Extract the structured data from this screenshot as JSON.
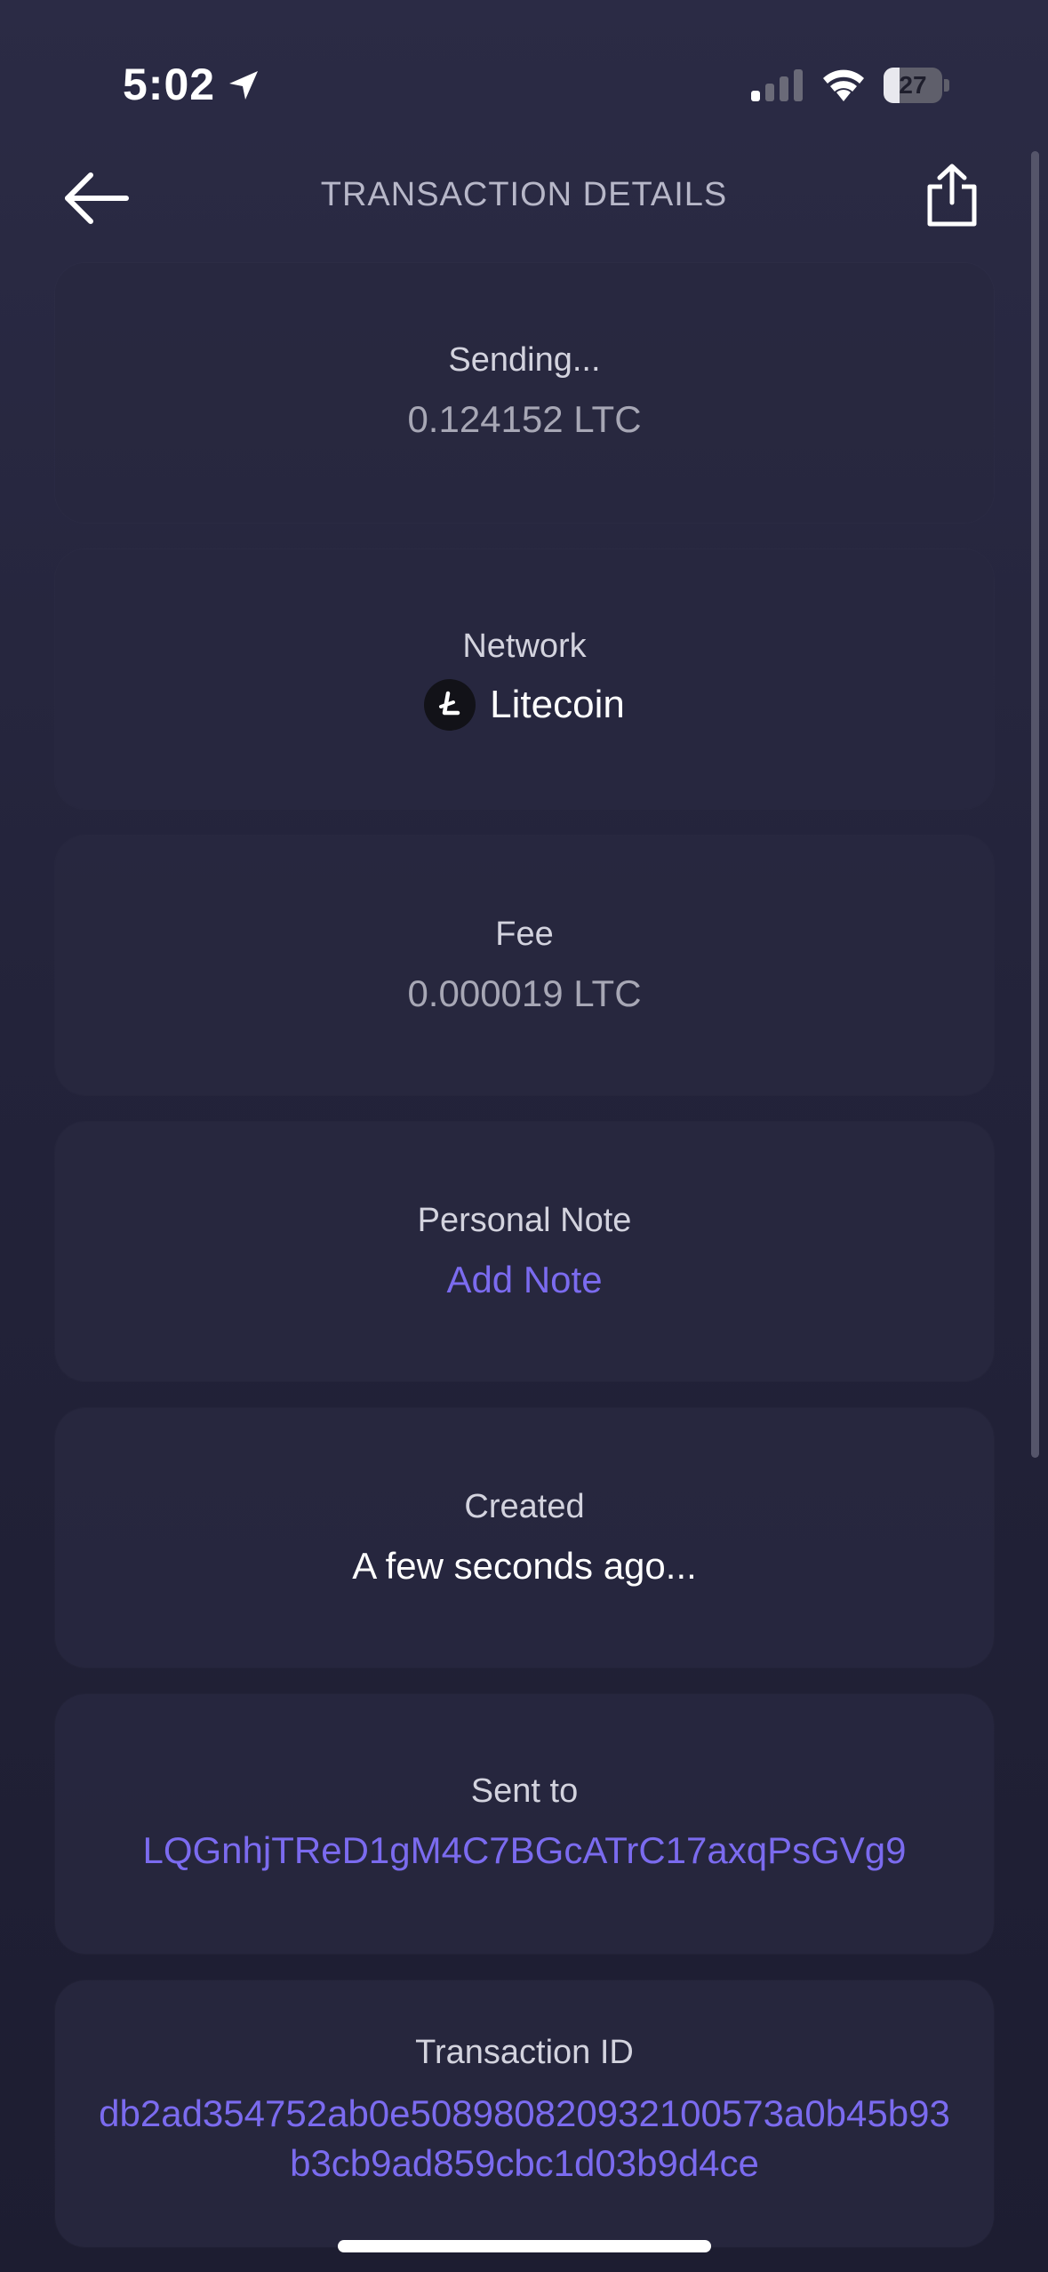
{
  "status_bar": {
    "time": "5:02",
    "battery_level": "27",
    "battery_fraction": 0.27,
    "icons": [
      "location-arrow-icon",
      "cellular-signal-icon",
      "wifi-icon",
      "battery-icon"
    ]
  },
  "header": {
    "title": "TRANSACTION DETAILS",
    "back_icon": "arrow-left-icon",
    "share_icon": "share-icon"
  },
  "cards": {
    "status": {
      "label": "Sending...",
      "value": "0.124152 LTC"
    },
    "network": {
      "label": "Network",
      "value": "Litecoin",
      "icon": "litecoin-icon"
    },
    "fee": {
      "label": "Fee",
      "value": "0.000019 LTC"
    },
    "note": {
      "label": "Personal Note",
      "action": "Add Note"
    },
    "created": {
      "label": "Created",
      "value": "A few seconds ago..."
    },
    "sent_to": {
      "label": "Sent to",
      "value": "LQGnhjTReD1gM4C7BGcATrC17axqPsGVg9"
    },
    "transaction_id": {
      "label": "Transaction ID",
      "value": "db2ad354752ab0e508980820932100573a0b45b93b3cb9ad859cbc1d03b9d4ce"
    }
  },
  "colors": {
    "accent": "#7b6bef",
    "background": "#23233a",
    "card": "#282840"
  }
}
